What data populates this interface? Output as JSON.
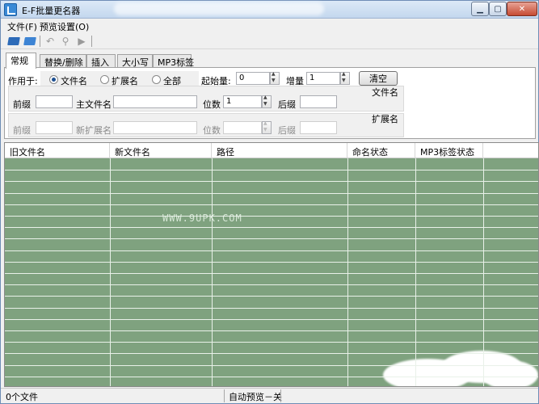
{
  "window": {
    "title": "E-F批量更名器"
  },
  "menu": {
    "items": [
      "文件(F)",
      "预览设置(O)"
    ]
  },
  "toolbar": {
    "icons": [
      "open-folder-icon",
      "open-file-icon",
      "undo-icon",
      "search-icon",
      "play-icon"
    ]
  },
  "tabs": [
    "常规",
    "替换/删除",
    "插入",
    "大小写",
    "MP3标签"
  ],
  "general": {
    "apply_to_label": "作用于:",
    "apply_options": [
      "文件名",
      "扩展名",
      "全部"
    ],
    "apply_selected": "文件名",
    "start_label": "起始量:",
    "start_value": "0",
    "increment_label": "增量",
    "increment_value": "1",
    "clear_button": "清空",
    "filename_group": {
      "title": "文件名",
      "prefix_label": "前缀",
      "prefix_value": "",
      "main_label": "主文件名",
      "main_value": "",
      "digits_label": "位数",
      "digits_value": "1",
      "suffix_label": "后缀",
      "suffix_value": ""
    },
    "extension_group": {
      "title": "扩展名",
      "prefix_label": "前缀",
      "prefix_value": "",
      "main_label": "新扩展名",
      "main_value": "",
      "digits_label": "位数",
      "digits_value": "",
      "suffix_label": "后缀",
      "suffix_value": ""
    }
  },
  "table": {
    "columns": [
      "旧文件名",
      "新文件名",
      "路径",
      "命名状态",
      "MP3标签状态"
    ],
    "watermark": "WWW.9UPK.COM",
    "rows": []
  },
  "status": {
    "file_count": "0个文件",
    "auto_preview": "自动预览－关"
  },
  "colors": {
    "table_bg": "#7fa27f",
    "grid_line": "#e9f1e9"
  }
}
